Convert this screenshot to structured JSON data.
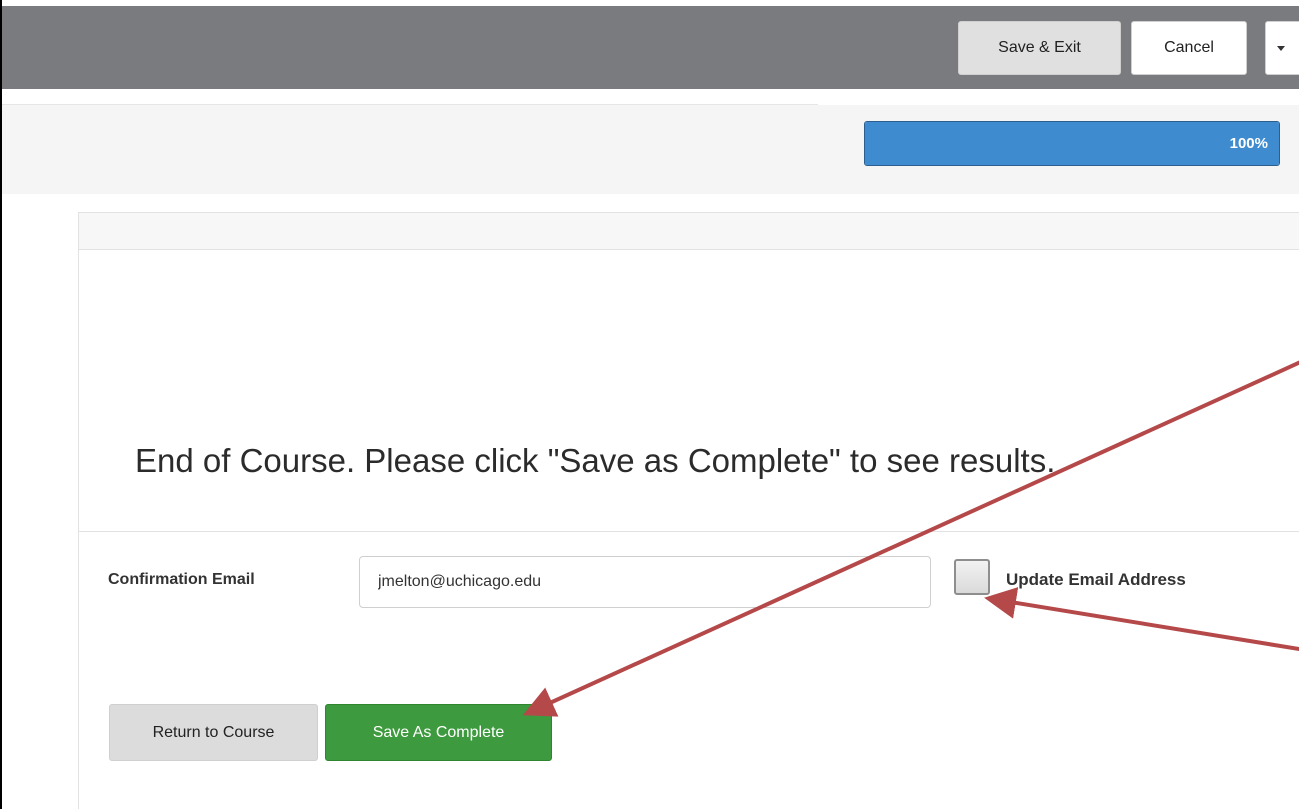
{
  "toolbar": {
    "save_exit_label": "Save & Exit",
    "cancel_label": "Cancel",
    "dropdown_icon": "caret-down-icon"
  },
  "progress": {
    "value": 1.0,
    "label": "100%",
    "color": "#3f8bd0"
  },
  "content": {
    "message": "End of Course. Please click \"Save as Complete\" to see results."
  },
  "email_form": {
    "label": "Confirmation Email",
    "value": "jmelton@uchicago.edu",
    "checkbox_label": "Update Email Address",
    "checkbox_checked": false
  },
  "actions": {
    "return_label": "Return to Course",
    "complete_label": "Save As Complete",
    "complete_color": "#3e9a3e"
  },
  "annotation": {
    "arrow_color": "#b5494a"
  }
}
